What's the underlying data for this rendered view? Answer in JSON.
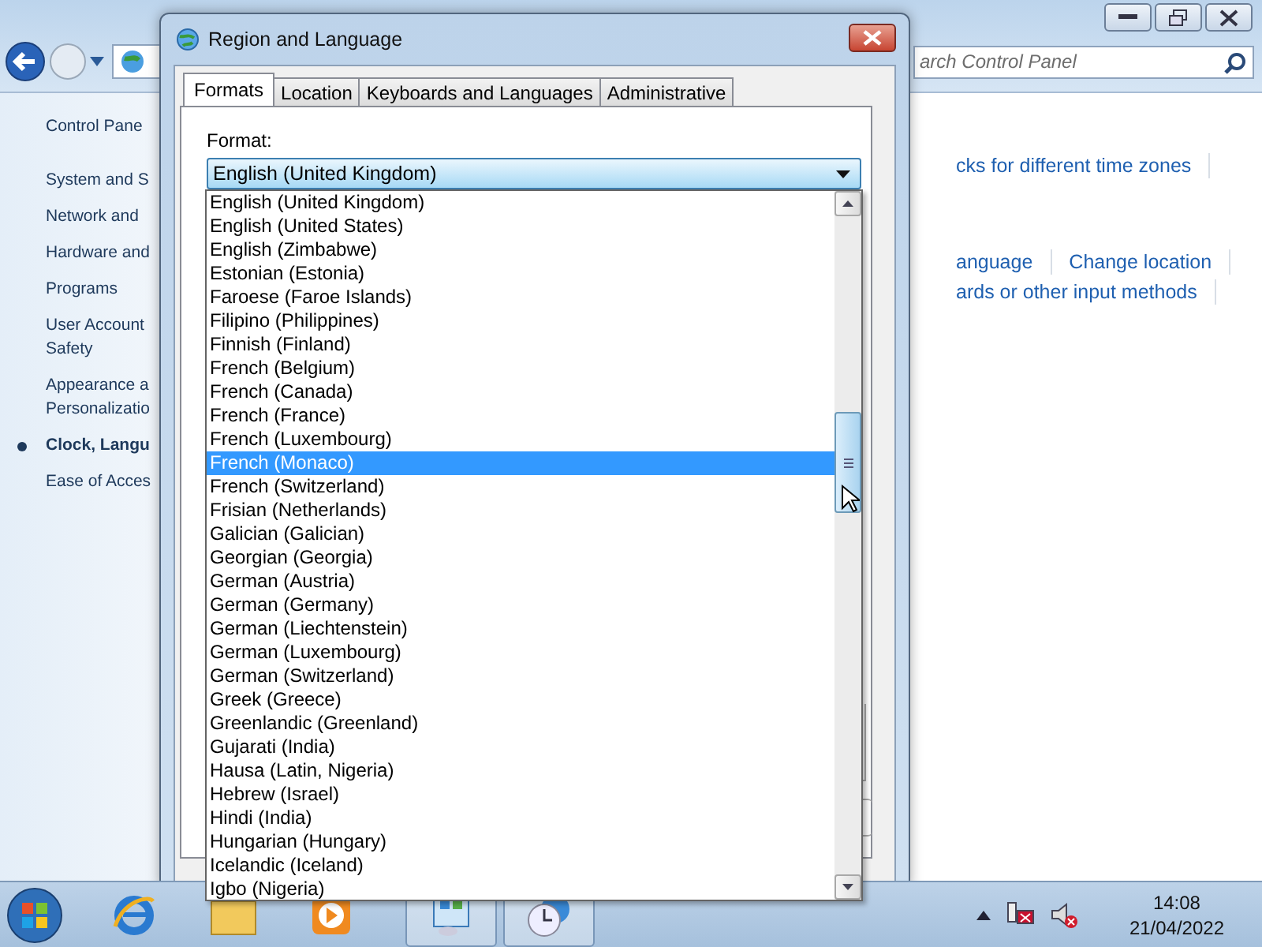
{
  "control_panel": {
    "search": {
      "placeholder": "arch Control Panel"
    },
    "sidebar": {
      "home": "Control Pane",
      "items": [
        {
          "lines": [
            "System and S"
          ],
          "selected": false
        },
        {
          "lines": [
            "Network and"
          ],
          "selected": false
        },
        {
          "lines": [
            "Hardware and"
          ],
          "selected": false
        },
        {
          "lines": [
            "Programs"
          ],
          "selected": false
        },
        {
          "lines": [
            "User Account",
            "Safety"
          ],
          "selected": false
        },
        {
          "lines": [
            "Appearance a",
            "Personalizatio"
          ],
          "selected": false
        },
        {
          "lines": [
            "Clock, Langu"
          ],
          "selected": true
        },
        {
          "lines": [
            "Ease of Acces"
          ],
          "selected": false
        }
      ]
    },
    "link_groups": [
      [
        [
          "cks for different time zones"
        ]
      ],
      [
        [
          "anguage",
          "Change location"
        ],
        [
          "ards or other input methods"
        ]
      ]
    ]
  },
  "dialog": {
    "title": "Region and Language",
    "tabs": [
      {
        "label": "Formats",
        "selected": true
      },
      {
        "label": "Location",
        "selected": false
      },
      {
        "label": "Keyboards and Languages",
        "selected": false
      },
      {
        "label": "Administrative",
        "selected": false
      }
    ],
    "format_label": "Format:",
    "format_value": "English (United Kingdom)",
    "options": [
      {
        "label": "English (United Kingdom)",
        "selected": false
      },
      {
        "label": "English (United States)",
        "selected": false
      },
      {
        "label": "English (Zimbabwe)",
        "selected": false
      },
      {
        "label": "Estonian (Estonia)",
        "selected": false
      },
      {
        "label": "Faroese (Faroe Islands)",
        "selected": false
      },
      {
        "label": "Filipino (Philippines)",
        "selected": false
      },
      {
        "label": "Finnish (Finland)",
        "selected": false
      },
      {
        "label": "French (Belgium)",
        "selected": false
      },
      {
        "label": "French (Canada)",
        "selected": false
      },
      {
        "label": "French (France)",
        "selected": false
      },
      {
        "label": "French (Luxembourg)",
        "selected": false
      },
      {
        "label": "French (Monaco)",
        "selected": true
      },
      {
        "label": "French (Switzerland)",
        "selected": false
      },
      {
        "label": "Frisian (Netherlands)",
        "selected": false
      },
      {
        "label": "Galician (Galician)",
        "selected": false
      },
      {
        "label": "Georgian (Georgia)",
        "selected": false
      },
      {
        "label": "German (Austria)",
        "selected": false
      },
      {
        "label": "German (Germany)",
        "selected": false
      },
      {
        "label": "German (Liechtenstein)",
        "selected": false
      },
      {
        "label": "German (Luxembourg)",
        "selected": false
      },
      {
        "label": "German (Switzerland)",
        "selected": false
      },
      {
        "label": "Greek (Greece)",
        "selected": false
      },
      {
        "label": "Greenlandic (Greenland)",
        "selected": false
      },
      {
        "label": "Gujarati (India)",
        "selected": false
      },
      {
        "label": "Hausa (Latin, Nigeria)",
        "selected": false
      },
      {
        "label": "Hebrew (Israel)",
        "selected": false
      },
      {
        "label": "Hindi (India)",
        "selected": false
      },
      {
        "label": "Hungarian (Hungary)",
        "selected": false
      },
      {
        "label": "Icelandic (Iceland)",
        "selected": false
      },
      {
        "label": "Igbo (Nigeria)",
        "selected": false
      }
    ]
  },
  "taskbar": {
    "time": "14:08",
    "date": "21/04/2022"
  }
}
